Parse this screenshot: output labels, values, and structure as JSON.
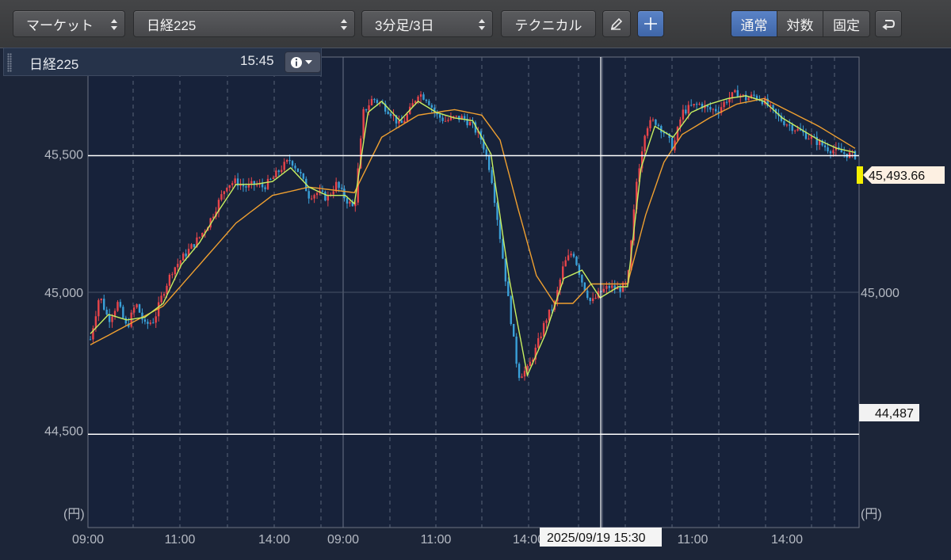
{
  "toolbar": {
    "market_select": "マーケット",
    "symbol_select": "日経225",
    "interval_select": "3分足/3日",
    "technical_button": "テクニカル",
    "pencil_icon": "pencil-icon",
    "crosshair_icon": "crosshair-icon",
    "scale_modes": [
      {
        "label": "通常",
        "active": true
      },
      {
        "label": "対数",
        "active": false
      },
      {
        "label": "固定",
        "active": false
      }
    ],
    "back_icon": "return-icon"
  },
  "info_panel": {
    "symbol": "日経225",
    "time": "15:45",
    "info_icon": "info-icon"
  },
  "chart_data": {
    "type": "candlestick",
    "y_unit_left": "(円)",
    "y_unit_right": "(円)",
    "y_ticks_left": [
      "45,500",
      "45,000",
      "44,500"
    ],
    "y_ticks_right": [
      "45,000"
    ],
    "ylim": [
      44150,
      45850
    ],
    "x_tick_labels": [
      "09:00",
      "11:00",
      "14:00",
      "09:00",
      "11:00",
      "14:00",
      "11:00",
      "14:00"
    ],
    "crosshair_label": "2025/09/19 15:30",
    "last_price_label": "45,493.66",
    "horizontal_line_label": "44,487",
    "horizontal_line_value": 44487,
    "last_price_value": 45493.66,
    "close_path": [
      [
        0,
        44830
      ],
      [
        2,
        44990
      ],
      [
        4,
        44900
      ],
      [
        6,
        44960
      ],
      [
        8,
        44870
      ],
      [
        10,
        44960
      ],
      [
        12,
        44880
      ],
      [
        14,
        44900
      ],
      [
        16,
        45000
      ],
      [
        18,
        45080
      ],
      [
        20,
        45120
      ],
      [
        22,
        45160
      ],
      [
        24,
        45200
      ],
      [
        26,
        45250
      ],
      [
        28,
        45320
      ],
      [
        30,
        45390
      ],
      [
        32,
        45400
      ],
      [
        34,
        45380
      ],
      [
        36,
        45390
      ],
      [
        38,
        45380
      ],
      [
        40,
        45410
      ],
      [
        42,
        45450
      ],
      [
        44,
        45480
      ],
      [
        46,
        45430
      ],
      [
        48,
        45350
      ],
      [
        50,
        45360
      ],
      [
        52,
        45340
      ],
      [
        54,
        45390
      ],
      [
        56,
        45340
      ],
      [
        58,
        45300
      ],
      [
        60,
        45650
      ],
      [
        62,
        45700
      ],
      [
        64,
        45680
      ],
      [
        66,
        45650
      ],
      [
        68,
        45600
      ],
      [
        70,
        45650
      ],
      [
        72,
        45720
      ],
      [
        74,
        45700
      ],
      [
        76,
        45640
      ],
      [
        78,
        45620
      ],
      [
        80,
        45630
      ],
      [
        82,
        45630
      ],
      [
        84,
        45600
      ],
      [
        86,
        45550
      ],
      [
        88,
        45430
      ],
      [
        90,
        45200
      ],
      [
        92,
        44950
      ],
      [
        94,
        44700
      ],
      [
        96,
        44720
      ],
      [
        98,
        44800
      ],
      [
        100,
        44900
      ],
      [
        102,
        44960
      ],
      [
        104,
        45100
      ],
      [
        106,
        45150
      ],
      [
        108,
        45040
      ],
      [
        110,
        44960
      ],
      [
        112,
        45000
      ],
      [
        114,
        45020
      ],
      [
        116,
        45010
      ],
      [
        118,
        45030
      ],
      [
        120,
        45400
      ],
      [
        122,
        45600
      ],
      [
        124,
        45620
      ],
      [
        126,
        45580
      ],
      [
        128,
        45520
      ],
      [
        130,
        45650
      ],
      [
        132,
        45670
      ],
      [
        134,
        45680
      ],
      [
        136,
        45660
      ],
      [
        138,
        45660
      ],
      [
        140,
        45700
      ],
      [
        142,
        45720
      ],
      [
        144,
        45700
      ],
      [
        146,
        45710
      ],
      [
        148,
        45690
      ],
      [
        150,
        45650
      ],
      [
        152,
        45620
      ],
      [
        154,
        45600
      ],
      [
        156,
        45580
      ],
      [
        158,
        45560
      ],
      [
        160,
        45540
      ],
      [
        162,
        45520
      ],
      [
        164,
        45510
      ],
      [
        166,
        45500
      ],
      [
        168,
        45494
      ]
    ],
    "ma_short_path": [
      [
        0,
        44850
      ],
      [
        4,
        44920
      ],
      [
        8,
        44900
      ],
      [
        12,
        44910
      ],
      [
        16,
        44960
      ],
      [
        20,
        45100
      ],
      [
        24,
        45180
      ],
      [
        28,
        45290
      ],
      [
        32,
        45390
      ],
      [
        36,
        45390
      ],
      [
        40,
        45400
      ],
      [
        44,
        45450
      ],
      [
        48,
        45380
      ],
      [
        52,
        45350
      ],
      [
        56,
        45350
      ],
      [
        58,
        45320
      ],
      [
        61,
        45650
      ],
      [
        64,
        45690
      ],
      [
        68,
        45620
      ],
      [
        72,
        45690
      ],
      [
        76,
        45650
      ],
      [
        80,
        45630
      ],
      [
        84,
        45620
      ],
      [
        88,
        45500
      ],
      [
        92,
        45050
      ],
      [
        96,
        44700
      ],
      [
        100,
        44850
      ],
      [
        104,
        45050
      ],
      [
        108,
        45080
      ],
      [
        112,
        44980
      ],
      [
        116,
        45020
      ],
      [
        118,
        45020
      ],
      [
        121,
        45450
      ],
      [
        124,
        45600
      ],
      [
        128,
        45560
      ],
      [
        132,
        45650
      ],
      [
        136,
        45680
      ],
      [
        140,
        45700
      ],
      [
        144,
        45710
      ],
      [
        148,
        45690
      ],
      [
        152,
        45630
      ],
      [
        156,
        45590
      ],
      [
        160,
        45550
      ],
      [
        164,
        45520
      ],
      [
        168,
        45505
      ]
    ],
    "ma_long_path": [
      [
        0,
        44810
      ],
      [
        8,
        44880
      ],
      [
        16,
        44950
      ],
      [
        24,
        45100
      ],
      [
        32,
        45250
      ],
      [
        40,
        45350
      ],
      [
        48,
        45380
      ],
      [
        58,
        45360
      ],
      [
        64,
        45560
      ],
      [
        72,
        45640
      ],
      [
        80,
        45660
      ],
      [
        86,
        45640
      ],
      [
        90,
        45550
      ],
      [
        94,
        45300
      ],
      [
        98,
        45060
      ],
      [
        102,
        44960
      ],
      [
        106,
        44960
      ],
      [
        110,
        45030
      ],
      [
        118,
        45030
      ],
      [
        122,
        45280
      ],
      [
        126,
        45470
      ],
      [
        130,
        45570
      ],
      [
        136,
        45630
      ],
      [
        142,
        45680
      ],
      [
        148,
        45700
      ],
      [
        154,
        45650
      ],
      [
        160,
        45600
      ],
      [
        168,
        45520
      ]
    ]
  }
}
